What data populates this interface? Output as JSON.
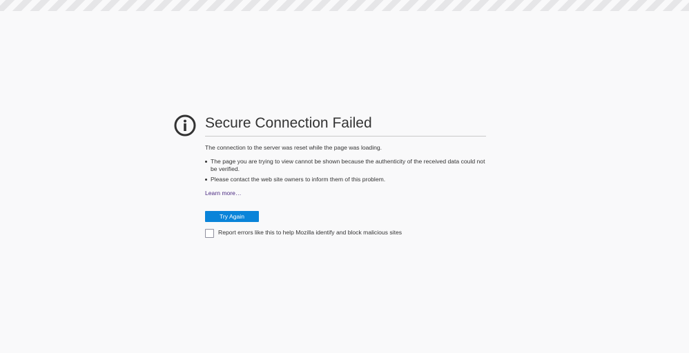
{
  "page": {
    "title": "Secure Connection Failed",
    "description": "The connection to the server was reset while the page was loading.",
    "bullets": [
      "The page you are trying to view cannot be shown because the authenticity of the received data could not be verified.",
      "Please contact the web site owners to inform them of this problem."
    ],
    "learn_more": "Learn more…",
    "try_again": "Try Again",
    "report_label": "Report errors like this to help Mozilla identify and block malicious sites",
    "report_checked": false
  },
  "icons": {
    "info": "info-icon"
  },
  "colors": {
    "accent": "#0a84d9",
    "link": "#4b2a82",
    "background": "#f9f9fa"
  }
}
